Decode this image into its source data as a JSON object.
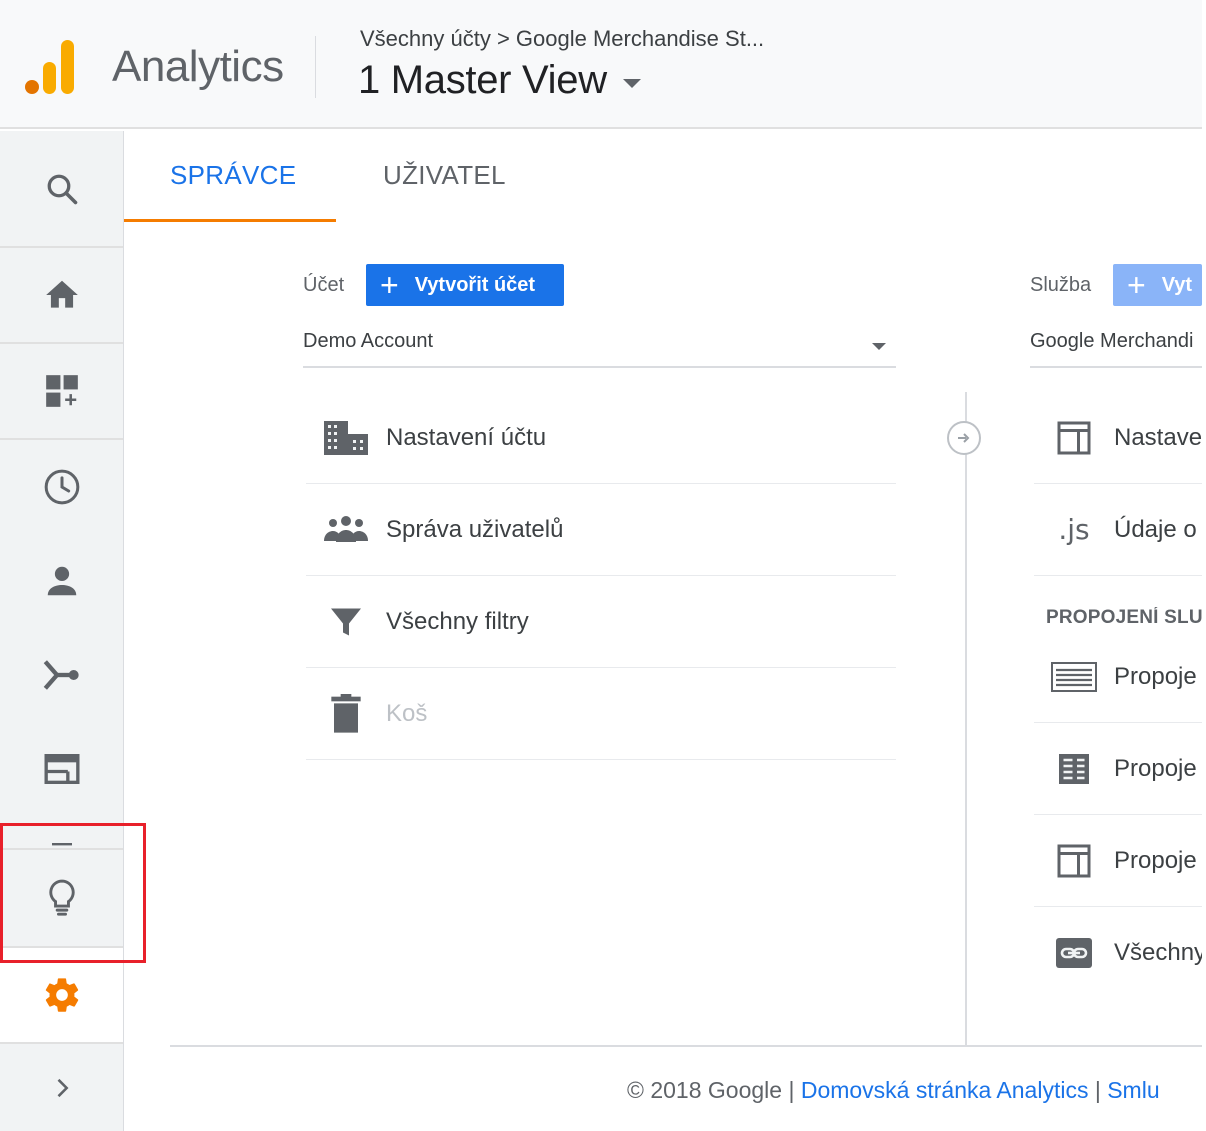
{
  "header": {
    "app_name": "Analytics",
    "breadcrumb": "Všechny účty > Google Merchandise St...",
    "view_name": "1 Master View"
  },
  "tabs": {
    "admin": "SPRÁVCE",
    "user": "UŽIVATEL"
  },
  "account": {
    "label": "Účet",
    "create_button": "Vytvořit účet",
    "selected": "Demo Account",
    "items": [
      {
        "label": "Nastavení účtu",
        "icon": "building-icon"
      },
      {
        "label": "Správa uživatelů",
        "icon": "people-icon"
      },
      {
        "label": "Všechny filtry",
        "icon": "filter-icon"
      },
      {
        "label": "Koš",
        "icon": "trash-icon"
      }
    ]
  },
  "property": {
    "label": "Služba",
    "create_button": "Vyt",
    "selected": "Google Merchandi",
    "items": [
      {
        "label": "Nastave",
        "icon": "property-settings-icon"
      },
      {
        "label": "Údaje o",
        "icon": "js-icon"
      }
    ],
    "section_heading": "PROPOJENÍ SLU",
    "link_items": [
      {
        "label": "Propoje",
        "icon": "adwords-link-icon"
      },
      {
        "label": "Propoje",
        "icon": "adexchange-link-icon"
      },
      {
        "label": "Propoje",
        "icon": "product-link-icon"
      },
      {
        "label": "Všechny",
        "icon": "all-products-link-icon"
      }
    ]
  },
  "footer": {
    "copyright": "© 2018 Google | ",
    "home_link": "Domovská stránka Analytics",
    "separator": " | ",
    "terms_link": "Smlu"
  },
  "colors": {
    "accent_blue": "#1a73e8",
    "tab_underline": "#f57c00",
    "gear": "#f57c00",
    "highlight_box": "#e8202a",
    "logo_orange": "#f9ab00",
    "logo_dark_orange": "#e37400"
  }
}
